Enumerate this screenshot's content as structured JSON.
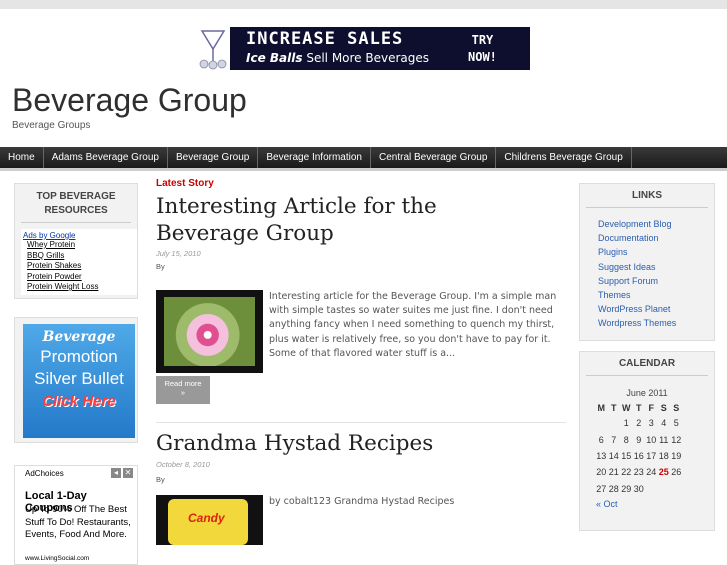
{
  "banner": {
    "line1": "INCREASE SALES",
    "line2_bold": "Ice Balls",
    "line2_rest": " Sell More Beverages",
    "cta_top": "TRY",
    "cta_bottom": "NOW!"
  },
  "site": {
    "title": "Beverage Group",
    "description": "Beverage Groups"
  },
  "nav": {
    "items": [
      "Home",
      "Adams Beverage Group",
      "Beverage Group",
      "Beverage Information",
      "Central Beverage Group",
      "Childrens Beverage Group"
    ]
  },
  "left_sidebar": {
    "top_resources_title": "TOP BEVERAGE RESOURCES",
    "ads_by_google": "Ads by Google",
    "ad_links": [
      "Whey Protein",
      "BBQ Grills",
      "Protein Shakes",
      "Protein Powder",
      "Protein Weight Loss"
    ],
    "promo": {
      "line1": "Beverage",
      "line2": "Promotion",
      "line3": "Silver Bullet",
      "line4": "Click Here"
    },
    "adchoices": {
      "label": "AdChoices",
      "prev": "◂",
      "next": "✕",
      "headline": "Local 1-Day Coupons",
      "body": "Up To 90% Off The Best Stuff To Do! Restaurants, Events, Food And More.",
      "url": "www.LivingSocial.com"
    }
  },
  "content": {
    "section_label": "Latest Story",
    "posts": [
      {
        "title": "Interesting Article for the Beverage Group",
        "date": "July 15, 2010",
        "byline": "By",
        "excerpt": "Interesting article for the Beverage Group. I'm a simple man with simple tastes so water suites me just fine. I don't need anything fancy when I need something to quench my thirst, plus water is relatively free, so you don't have to pay for it. Some of that flavored water stuff is a...",
        "read_more": "Read more",
        "read_more_arrow": "»"
      },
      {
        "title": "Grandma Hystad Recipes",
        "date": "October 8, 2010",
        "byline": "By",
        "excerpt": "by cobalt123 Grandma Hystad Recipes",
        "thumb_text": "Candy"
      }
    ]
  },
  "right_sidebar": {
    "links_title": "LINKS",
    "links": [
      "Development Blog",
      "Documentation",
      "Plugins",
      "Suggest Ideas",
      "Support Forum",
      "Themes",
      "WordPress Planet",
      "Wordpress Themes"
    ],
    "calendar_title": "CALENDAR",
    "calendar": {
      "month": "June 2011",
      "weekdays": [
        "M",
        "T",
        "W",
        "T",
        "F",
        "S",
        "S"
      ],
      "weeks": [
        [
          "",
          "",
          "1",
          "2",
          "3",
          "4",
          "5"
        ],
        [
          "6",
          "7",
          "8",
          "9",
          "10",
          "11",
          "12"
        ],
        [
          "13",
          "14",
          "15",
          "16",
          "17",
          "18",
          "19"
        ],
        [
          "20",
          "21",
          "22",
          "23",
          "24",
          "25",
          "26"
        ],
        [
          "27",
          "28",
          "29",
          "30",
          "",
          "",
          ""
        ]
      ],
      "today": "25",
      "prev_link": "« Oct"
    }
  }
}
